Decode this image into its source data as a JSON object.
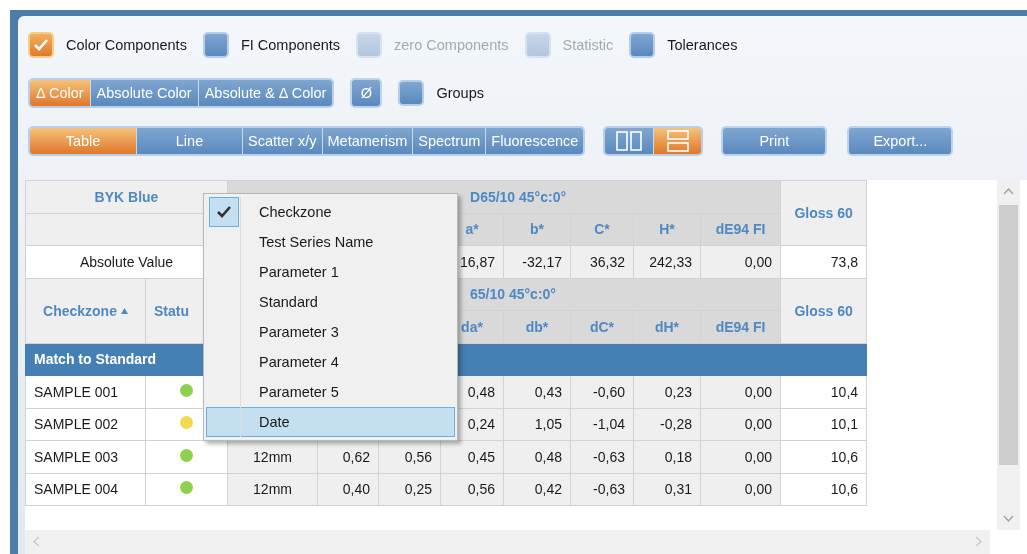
{
  "options": [
    {
      "label": "Color Components",
      "checked": true,
      "disabled": false
    },
    {
      "label": "FI Components",
      "checked": false,
      "disabled": false
    },
    {
      "label": "zero Components",
      "checked": false,
      "disabled": true
    },
    {
      "label": "Statistic",
      "checked": false,
      "disabled": true
    },
    {
      "label": "Tolerances",
      "checked": false,
      "disabled": false
    }
  ],
  "color_modes": [
    {
      "label": "Δ Color",
      "selected": true
    },
    {
      "label": "Absolute Color",
      "selected": false
    },
    {
      "label": "Absolute & Δ Color",
      "selected": false
    }
  ],
  "mean_button": "Ø",
  "groups": {
    "label": "Groups",
    "checked": false
  },
  "views": [
    {
      "label": "Table",
      "selected": true
    },
    {
      "label": "Line",
      "selected": false
    },
    {
      "label": "Scatter x/y",
      "selected": false
    },
    {
      "label": "Metamerism",
      "selected": false
    },
    {
      "label": "Spectrum",
      "selected": false
    },
    {
      "label": "Fluorescence",
      "selected": false
    }
  ],
  "layouts": [
    {
      "kind": "columns",
      "selected": false
    },
    {
      "kind": "rows",
      "selected": true
    }
  ],
  "actions": [
    "Print",
    "Export..."
  ],
  "table": {
    "standard_name": "BYK Blue",
    "upper_group": "D65/10  45°c:0°",
    "upper_columns": [
      "a*",
      "b*",
      "C*",
      "H*",
      "dE94 FI"
    ],
    "gloss_header": "Gloss 60",
    "absolute_label": "Absolute Value",
    "absolute_values": [
      "16,87",
      "-32,17",
      "36,32",
      "242,33",
      "0,00",
      "73,8"
    ],
    "checkzone_header": "Checkzone",
    "status_header": "Statu",
    "lower_group": "65/10  45°c:0°",
    "lower_columns": [
      "da*",
      "db*",
      "dC*",
      "dH*",
      "dE94 FI"
    ],
    "lower_gloss_header": "Gloss 60",
    "group_row": "Match to Standard",
    "rows": [
      {
        "checkzone": "SAMPLE 001",
        "color": "#8fd14f",
        "values": [
          "0,48",
          "0,43",
          "-0,60",
          "0,23",
          "0,00",
          "10,4"
        ]
      },
      {
        "checkzone": "SAMPLE 002",
        "color": "#f2d94e",
        "values": [
          "0,24",
          "1,05",
          "-1,04",
          "-0,28",
          "0,00",
          "10,1"
        ]
      },
      {
        "checkzone": "SAMPLE 003",
        "color": "#8fd14f",
        "values": [
          "12mm",
          "0,62",
          "0,56",
          "0,45",
          "0,48",
          "-0,63",
          "0,18",
          "0,00",
          "10,6"
        ]
      },
      {
        "checkzone": "SAMPLE 004",
        "color": "#8fd14f",
        "values": [
          "12mm",
          "0,40",
          "0,25",
          "0,56",
          "0,42",
          "-0,63",
          "0,31",
          "0,00",
          "10,6"
        ]
      }
    ]
  },
  "context_menu": {
    "items": [
      {
        "label": "Checkzone",
        "checked": true,
        "selected": false
      },
      {
        "label": "Test Series Name",
        "checked": false,
        "selected": false
      },
      {
        "label": "Parameter 1",
        "checked": false,
        "selected": false
      },
      {
        "label": "Standard",
        "checked": false,
        "selected": false
      },
      {
        "label": "Parameter 3",
        "checked": false,
        "selected": false
      },
      {
        "label": "Parameter 4",
        "checked": false,
        "selected": false
      },
      {
        "label": "Parameter 5",
        "checked": false,
        "selected": false
      },
      {
        "label": "Date",
        "checked": false,
        "selected": true
      }
    ]
  }
}
